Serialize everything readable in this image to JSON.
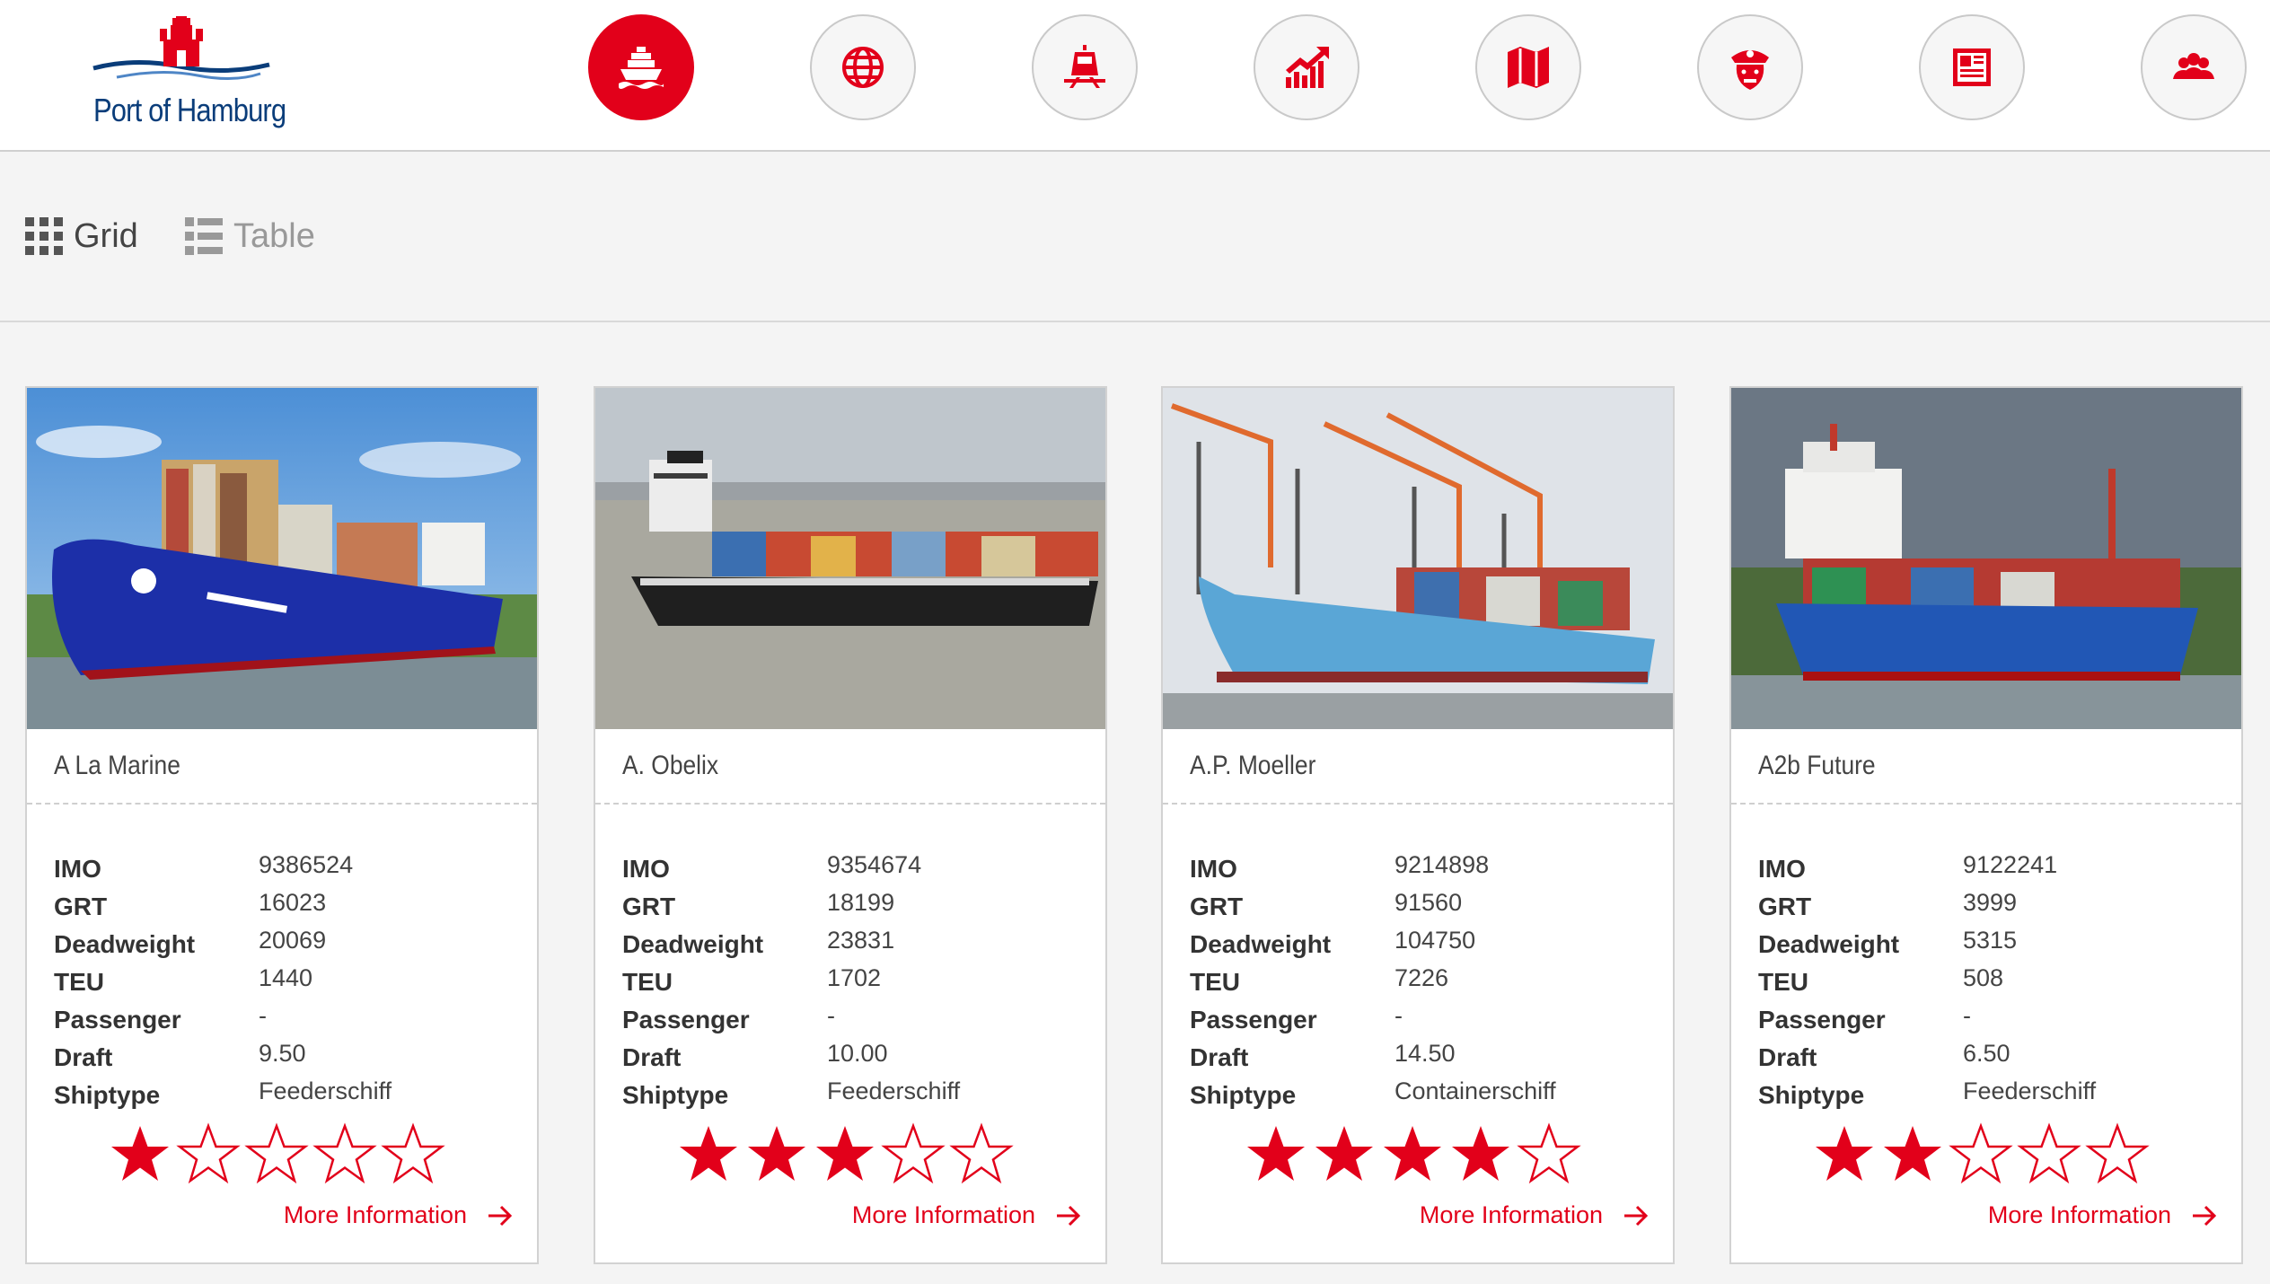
{
  "brand": {
    "logo_text": "Port of Hamburg",
    "accent": "#e2001a",
    "navy": "#0a3d7a"
  },
  "nav": [
    {
      "icon": "ship-icon",
      "active": true
    },
    {
      "icon": "globe-icon",
      "active": false
    },
    {
      "icon": "train-icon",
      "active": false
    },
    {
      "icon": "growth-chart-icon",
      "active": false
    },
    {
      "icon": "map-icon",
      "active": false
    },
    {
      "icon": "captain-icon",
      "active": false
    },
    {
      "icon": "newspaper-icon",
      "active": false
    },
    {
      "icon": "people-icon",
      "active": false
    }
  ],
  "view": {
    "grid_label": "Grid",
    "table_label": "Table",
    "selected": "Grid"
  },
  "spec_labels": {
    "imo": "IMO",
    "grt": "GRT",
    "deadweight": "Deadweight",
    "teu": "TEU",
    "passenger": "Passenger",
    "draft": "Draft",
    "shiptype": "Shiptype"
  },
  "more_label": "More Information",
  "ships": [
    {
      "name": "A La Marine",
      "imo": "9386524",
      "grt": "16023",
      "deadweight": "20069",
      "teu": "1440",
      "passenger": "-",
      "draft": "9.50",
      "shiptype": "Feederschiff",
      "rating": 1
    },
    {
      "name": "A. Obelix",
      "imo": "9354674",
      "grt": "18199",
      "deadweight": "23831",
      "teu": "1702",
      "passenger": "-",
      "draft": "10.00",
      "shiptype": "Feederschiff",
      "rating": 3
    },
    {
      "name": "A.P. Moeller",
      "imo": "9214898",
      "grt": "91560",
      "deadweight": "104750",
      "teu": "7226",
      "passenger": "-",
      "draft": "14.50",
      "shiptype": "Containerschiff",
      "rating": 4
    },
    {
      "name": "A2b Future",
      "imo": "9122241",
      "grt": "3999",
      "deadweight": "5315",
      "teu": "508",
      "passenger": "-",
      "draft": "6.50",
      "shiptype": "Feederschiff",
      "rating": 2
    }
  ],
  "rating_max": 5
}
